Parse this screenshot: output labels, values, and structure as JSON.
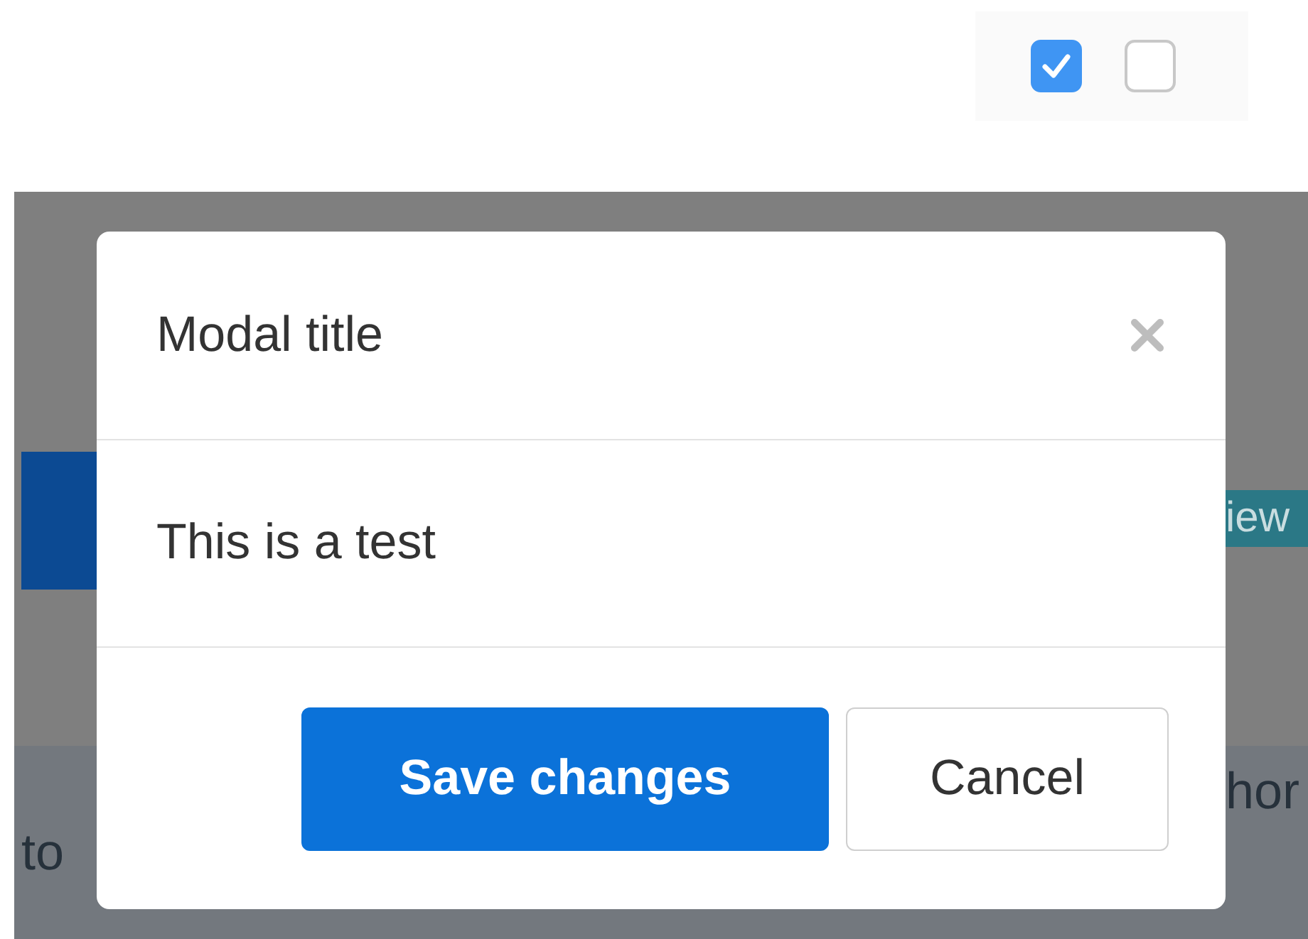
{
  "checkboxes": [
    {
      "checked": true
    },
    {
      "checked": false
    }
  ],
  "background": {
    "badge": "iew",
    "cells": [
      {
        "text": "hor"
      },
      {
        "text": "to"
      }
    ]
  },
  "modal": {
    "title": "Modal title",
    "body": "This is a test",
    "buttons": [
      {
        "label": "Save changes",
        "kind": "primary"
      },
      {
        "label": "Cancel",
        "kind": "secondary"
      }
    ]
  }
}
